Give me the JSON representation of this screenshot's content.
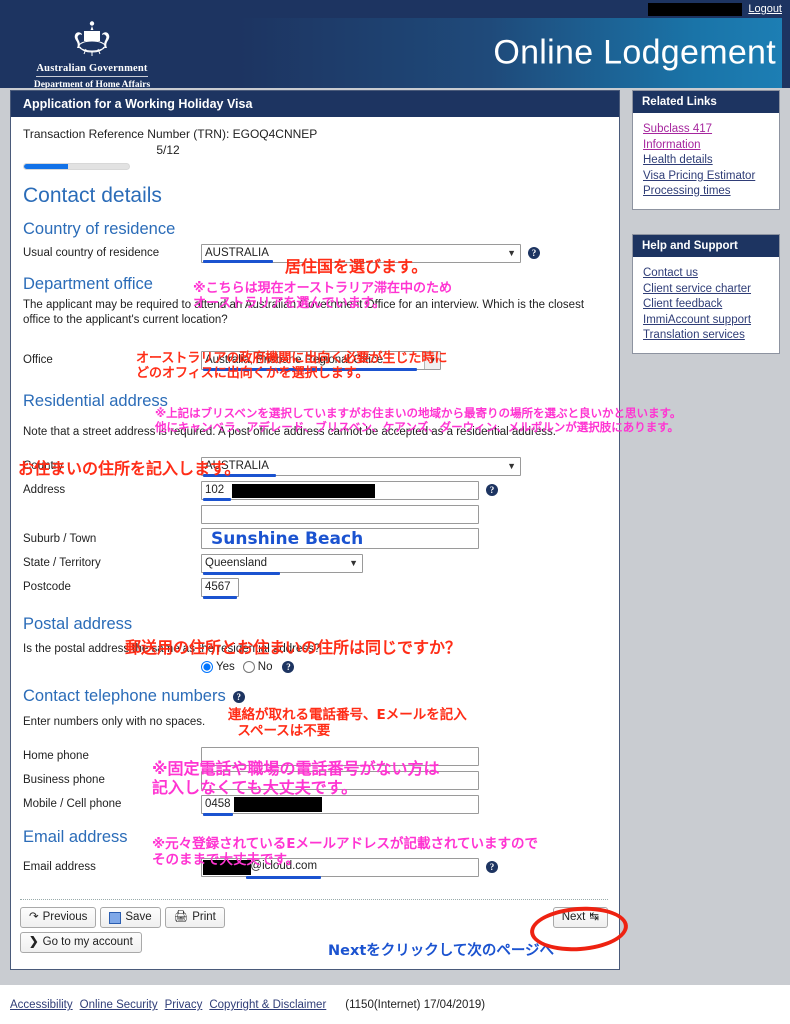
{
  "topbar": {
    "username_redacted": true,
    "logout_label": "Logout"
  },
  "masthead": {
    "gov_line1": "Australian Government",
    "gov_line2": "Department of Home Affairs",
    "site_title": "Online Lodgement",
    "crest_icon": "australian-coat-of-arms"
  },
  "form": {
    "title": "Application for a Working Holiday Visa",
    "trn_line": "Transaction Reference Number (TRN): EGOQ4CNNEP",
    "page_counter": "5/12",
    "progress_percent": 42,
    "progress_color": "#1272e8",
    "heading": "Contact details",
    "country_of_residence": {
      "heading": "Country of residence",
      "label": "Usual country of residence",
      "value": "AUSTRALIA",
      "help_icon": "help-icon"
    },
    "department_office": {
      "heading": "Department office",
      "note": "The applicant may be required to attend an Australian Government Office for an interview. Which is the closest office to the applicant's current location?",
      "label": "Office",
      "value": "Australia, Brisbane Regional Office"
    },
    "residential_address": {
      "heading": "Residential address",
      "note": "Note that a street address is required. A post office address cannot be accepted as a residential address.",
      "country_label": "Country",
      "country_value": "AUSTRALIA",
      "address_label": "Address",
      "address_value": "102",
      "address_line2_value": "",
      "suburb_label": "Suburb / Town",
      "suburb_value": "Sunshine Beach",
      "state_label": "State / Territory",
      "state_value": "Queensland",
      "postcode_label": "Postcode",
      "postcode_value": "4567"
    },
    "postal_address": {
      "heading": "Postal address",
      "question": "Is the postal address the same as the residential address?",
      "option_yes": "Yes",
      "option_no": "No",
      "selected": "Yes"
    },
    "telephone": {
      "heading": "Contact telephone numbers",
      "note": "Enter numbers only with no spaces.",
      "home_label": "Home phone",
      "home_value": "",
      "business_label": "Business phone",
      "business_value": "",
      "mobile_label": "Mobile / Cell phone",
      "mobile_value": "0458"
    },
    "email": {
      "heading": "Email address",
      "label": "Email address",
      "value": "6@icloud.com"
    },
    "buttons": {
      "previous": "Previous",
      "save": "Save",
      "print": "Print",
      "go_to_my_account": "Go to my account",
      "next": "Next"
    }
  },
  "annotations": {
    "a1": "居住国を選びます。",
    "a2": "※こちらは現在オーストラリア滞在中のため\nオーストラリアを選んでいます。",
    "a3": "オーストラリアの政府機関に出向く必要が生じた時に\nどのオフィスに出向くかを選択します。",
    "a4": "※上記はブリスベンを選択していますがお住まいの地域から最寄りの場所を選ぶと良いかと思います。\n他にキャンベラ、アデレード、ブリスベン、ケアンズ、ダーウィン、メルボルンが選択肢にあります。",
    "a5": "お住まいの住所を記入します。",
    "a6": "郵送用の住所とお住まいの住所は同じですか？",
    "a7": "連絡が取れる電話番号、Eメールを記入\n  スペースは不要",
    "a8": "※固定電話や職場の電話番号がない方は\n記入しなくても大丈夫です。",
    "a9": "※元々登録されているEメールアドレスが記載されていますので\nそのままで大丈夫です。",
    "a10": "Nextをクリックして次のページへ"
  },
  "sidebar": {
    "related_links": {
      "title": "Related Links",
      "items": [
        {
          "label": "Subclass 417",
          "style": "magenta"
        },
        {
          "label": "Information",
          "style": "magenta"
        },
        {
          "label": "Health details",
          "style": "navy"
        },
        {
          "label": "Visa Pricing Estimator",
          "style": "navy"
        },
        {
          "label": "Processing times",
          "style": "navy"
        }
      ]
    },
    "help_and_support": {
      "title": "Help and Support",
      "items": [
        {
          "label": "Contact us"
        },
        {
          "label": "Client service charter"
        },
        {
          "label": "Client feedback"
        },
        {
          "label": "ImmiAccount support"
        },
        {
          "label": "Translation services"
        }
      ]
    }
  },
  "footer": {
    "links": [
      "Accessibility",
      "Online Security",
      "Privacy",
      "Copyright & Disclaimer"
    ],
    "stamp": "(1150(Internet) 17/04/2019)"
  }
}
